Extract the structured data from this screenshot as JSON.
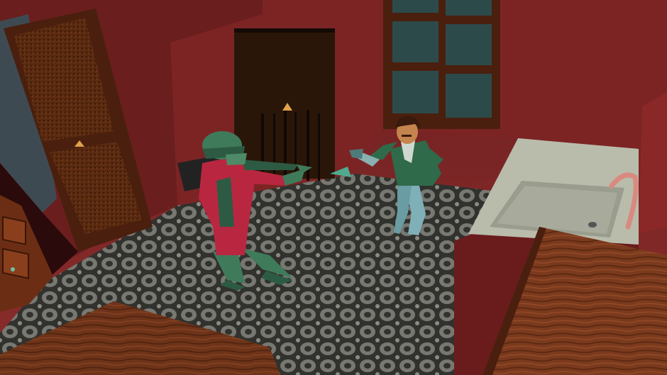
{
  "scene": {
    "colors": {
      "wall": "#7a2626",
      "wall_dark": "#4a1414",
      "floor_light": "#8e8e86",
      "floor_dark": "#3a3a36",
      "wood": "#7b3a1e",
      "wood_dark": "#4a1f0e",
      "door_panel": "#5a2a10",
      "cabinet": "#2a1608",
      "window_glass": "#2d4a4a",
      "sink": "#b9bcab",
      "zombie_coat": "#b8273f",
      "zombie_skin": "#3f7a5a",
      "player_jacket": "#2f6a4a",
      "player_pants": "#7fb0b8"
    },
    "objects": [
      "left-door",
      "open-cabinet",
      "window",
      "sink-counter",
      "wood-table-foreground-left",
      "wood-counter-foreground-right",
      "drawer-unit",
      "zombie-soldier",
      "player-character"
    ]
  }
}
